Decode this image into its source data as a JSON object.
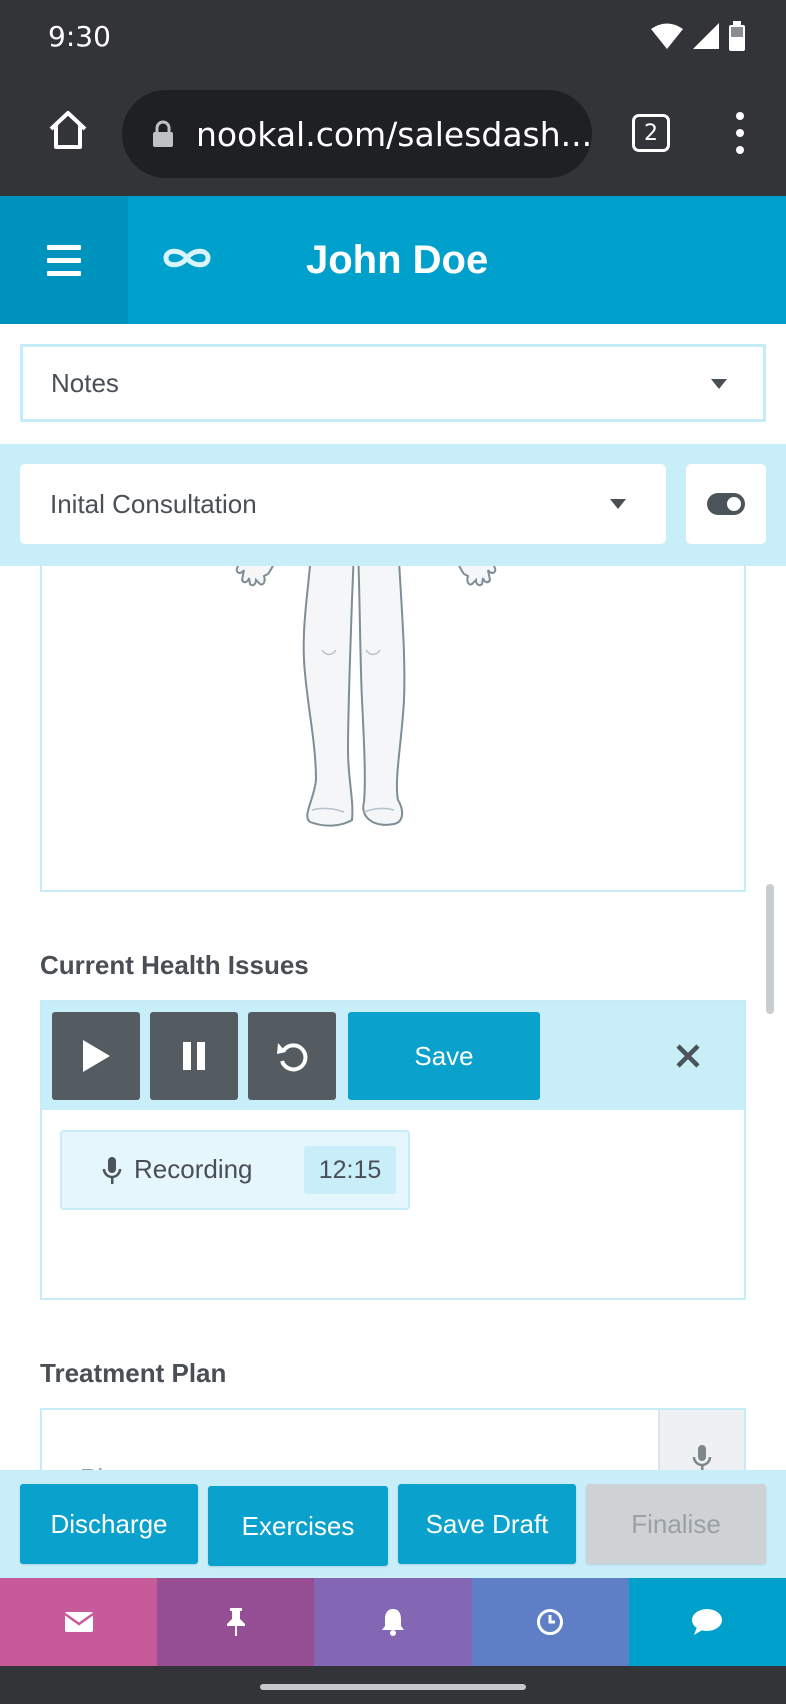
{
  "status_bar": {
    "time": "9:30"
  },
  "browser": {
    "url": "nookal.com/salesdash...",
    "tab_count": "2"
  },
  "header": {
    "patient_name": "John Doe"
  },
  "notes_select": {
    "value": "Notes"
  },
  "consult_select": {
    "value": "Inital Consultation"
  },
  "sections": {
    "current_health": {
      "label": "Current Health Issues",
      "save_label": "Save",
      "recording_label": "Recording",
      "recording_time": "12:15"
    },
    "treatment_plan": {
      "label": "Treatment Plan",
      "placeholder": "Please enter"
    }
  },
  "actions": {
    "discharge": "Discharge",
    "exercises": "Exercises",
    "save_draft": "Save Draft",
    "finalise": "Finalise"
  },
  "icons": {
    "home": "home-icon",
    "lock": "lock-icon",
    "menu": "hamburger-icon",
    "logo": "infinity-logo",
    "toggle": "toggle-icon",
    "play": "play-icon",
    "pause": "pause-icon",
    "reset": "undo-icon",
    "close": "close-icon",
    "mic": "microphone-icon",
    "envelope": "envelope-icon",
    "pin": "pin-icon",
    "bell": "bell-icon",
    "clock": "clock-icon",
    "chat": "chat-icon"
  },
  "colors": {
    "primary": "#00a0cc",
    "light_accent": "#c8eefa",
    "nav_mail": "#c75a98",
    "nav_pin": "#954e94",
    "nav_bell": "#8367b4",
    "nav_clock": "#5e7ec6",
    "nav_chat": "#00a0cc"
  }
}
